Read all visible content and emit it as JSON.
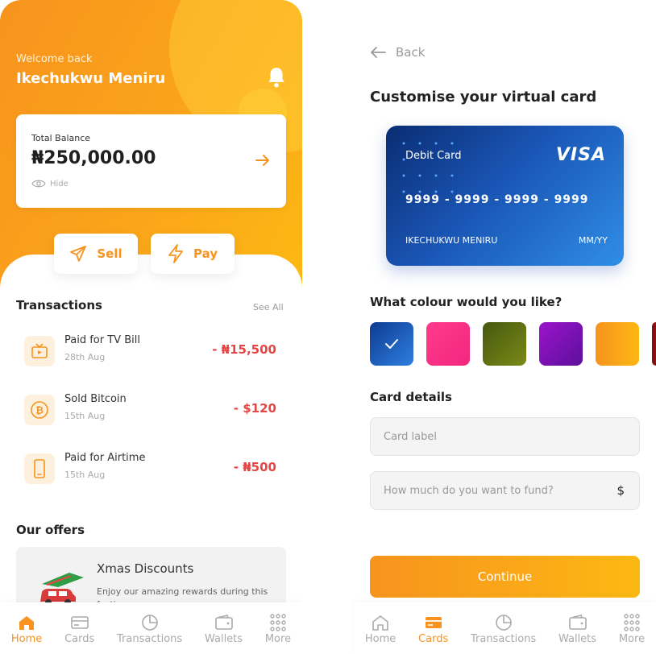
{
  "left": {
    "welcome": "Welcome back",
    "username": "Ikechukwu Meniru",
    "balance": {
      "label": "Total Balance",
      "amount": "₦250,000.00",
      "hide": "Hide"
    },
    "actions": {
      "sell": "Sell",
      "pay": "Pay"
    },
    "transactions": {
      "title": "Transactions",
      "see_all": "See All",
      "items": [
        {
          "title": "Paid for TV Bill",
          "date": "28th Aug",
          "amount": "- ₦15,500",
          "icon": "tv-icon"
        },
        {
          "title": "Sold Bitcoin",
          "date": "15th Aug",
          "amount": "- $120",
          "icon": "bitcoin-icon"
        },
        {
          "title": "Paid for Airtime",
          "date": "15th Aug",
          "amount": "- ₦500",
          "icon": "phone-icon"
        }
      ]
    },
    "offers": {
      "title": "Our offers",
      "card_title": "Xmas Discounts",
      "card_desc": "Enjoy our amazing rewards during this festive"
    },
    "tabs": [
      "Home",
      "Cards",
      "Transactions",
      "Wallets",
      "More"
    ],
    "active_tab": "Home"
  },
  "right": {
    "back": "Back",
    "title": "Customise your virtual card",
    "card": {
      "type": "Debit Card",
      "brand": "VISA",
      "number": "9999 - 9999 - 9999 - 9999",
      "name": "IKECHUKWU MENIRU",
      "expiry": "MM/YY"
    },
    "colour_title": "What colour would you like?",
    "colours": [
      "#1a4fb5",
      "#f7328a",
      "#5c6b12",
      "#7a12b8",
      "#f7931e",
      "#8a0f0f"
    ],
    "selected_colour_index": 0,
    "details_title": "Card details",
    "label_placeholder": "Card label",
    "fund_placeholder": "How much do you want to fund?",
    "currency": "$",
    "continue": "Continue",
    "tabs": [
      "Home",
      "Cards",
      "Transactions",
      "Wallets",
      "More"
    ],
    "active_tab": "Cards"
  },
  "colors": {
    "accent": "#f7931e",
    "negative": "#e64545"
  }
}
